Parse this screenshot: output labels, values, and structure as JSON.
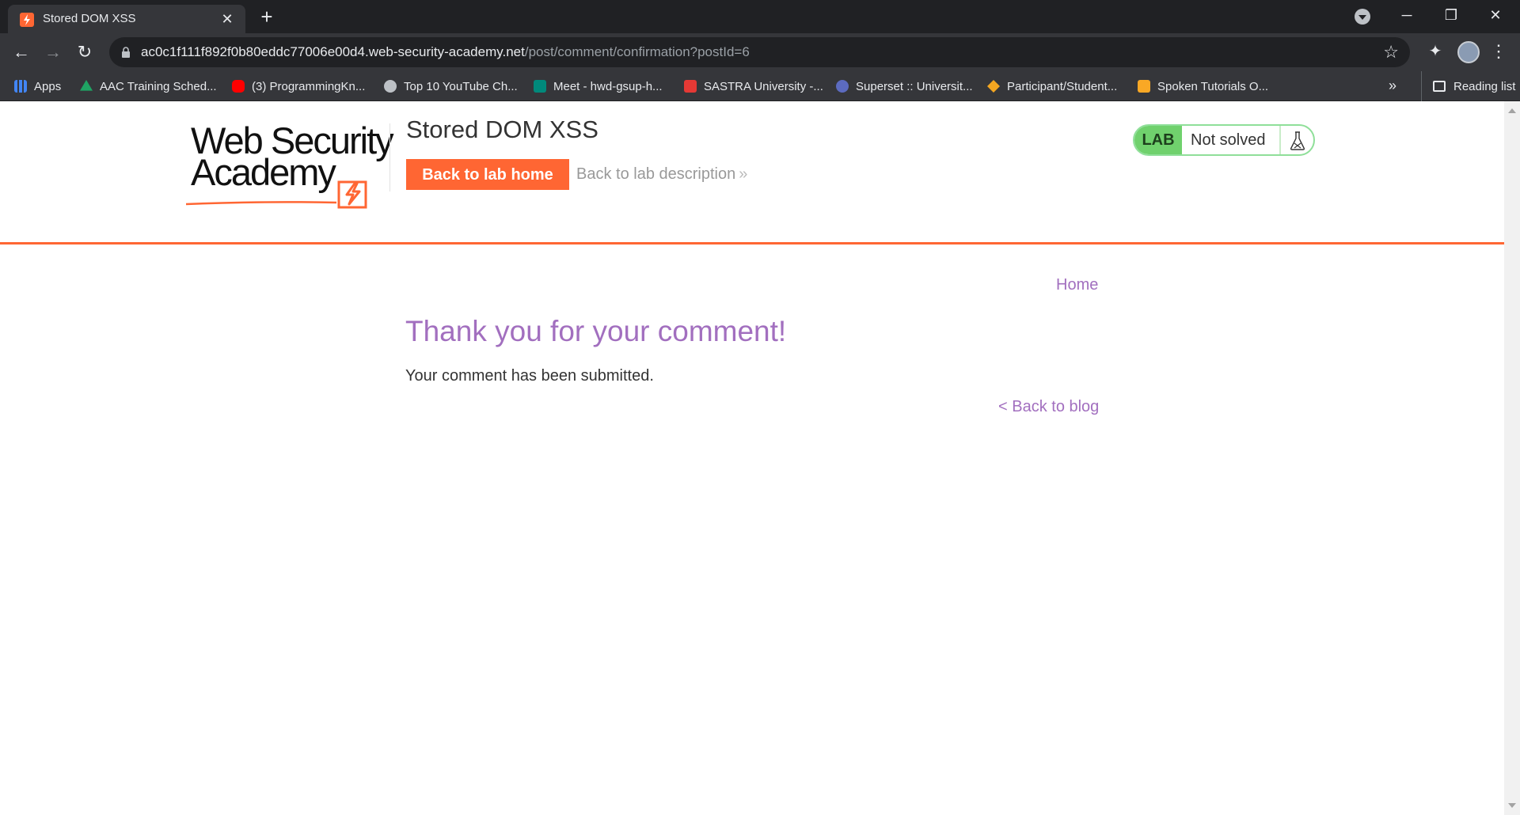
{
  "browser": {
    "tab_title": "Stored DOM XSS",
    "tab_close_glyph": "✕",
    "new_tab_glyph": "+",
    "url_host": "ac0c1f111f892f0b80eddc77006e00d4.web-security-academy.net",
    "url_path": "/post/comment/confirmation?postId=6",
    "bookmarks": [
      {
        "label": "Apps",
        "icon": "apps-grid-icon",
        "color": "#4285f4"
      },
      {
        "label": "AAC Training Sched...",
        "icon": "google-drive-icon",
        "color": "#1fa463"
      },
      {
        "label": "(3) ProgrammingKn...",
        "icon": "youtube-icon",
        "color": "#ff0000"
      },
      {
        "label": "Top 10 YouTube Ch...",
        "icon": "sparkle-icon",
        "color": "#bdc1c6"
      },
      {
        "label": "Meet - hwd-gsup-h...",
        "icon": "google-meet-icon",
        "color": "#00897b"
      },
      {
        "label": "SASTRA University -...",
        "icon": "sastra-icon",
        "color": "#e53935"
      },
      {
        "label": "Superset :: Universit...",
        "icon": "superset-icon",
        "color": "#5c6bc0"
      },
      {
        "label": "Participant/Student...",
        "icon": "participant-icon",
        "color": "#f4a621"
      },
      {
        "label": "Spoken Tutorials O...",
        "icon": "spoken-tutorial-icon",
        "color": "#f9a825"
      }
    ],
    "bookmarks_more": "»",
    "reading_list": "Reading list"
  },
  "header": {
    "logo_line1": "Web Security",
    "logo_line2": "Academy",
    "lab_title": "Stored DOM XSS",
    "back_to_lab_home": "Back to lab home",
    "back_to_lab_description": "Back to lab description",
    "description_arrow": "»",
    "status_badge": "LAB",
    "status_text": "Not solved"
  },
  "content": {
    "nav_home": "Home",
    "heading": "Thank you for your comment!",
    "message": "Your comment has been submitted.",
    "back_to_blog": "< Back to blog"
  },
  "colors": {
    "accent_orange": "#ff6633",
    "link_purple": "#a26fbf",
    "lab_green": "#70d16d"
  }
}
